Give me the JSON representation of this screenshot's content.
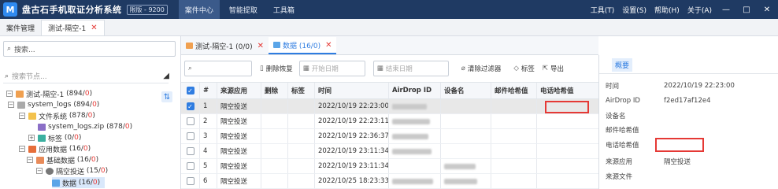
{
  "titlebar": {
    "logo": "M",
    "app_title": "盘古石手机取证分析系统",
    "edition": "限版 - 9200",
    "nav_tabs": [
      "案件中心",
      "智能提取",
      "工具箱"
    ],
    "menus": [
      "工具(T)",
      "设置(S)",
      "帮助(H)",
      "关于(A)"
    ],
    "win_buttons": [
      "—",
      "□",
      "✕"
    ]
  },
  "case_tabs": [
    {
      "label": "案件管理"
    },
    {
      "label": "测试-隔空-1",
      "close": "✕"
    }
  ],
  "left": {
    "search_placeholder": "搜索...",
    "filter_placeholder": "搜索节点...",
    "tree": [
      {
        "label": "测试-隔空-1",
        "count_a": "894",
        "count_b": "0"
      },
      {
        "label": "system_logs",
        "count_a": "894",
        "count_b": "0"
      },
      {
        "label": "文件系统",
        "count_a": "878",
        "count_b": "0"
      },
      {
        "label": "system_logs.zip",
        "count_a": "878",
        "count_b": "0"
      },
      {
        "label": "标签",
        "count_a": "0",
        "count_b": "0"
      },
      {
        "label": "应用数据",
        "count_a": "16",
        "count_b": "0"
      },
      {
        "label": "基础数据",
        "count_a": "16",
        "count_b": "0"
      },
      {
        "label": "隔空投送",
        "count_a": "15",
        "count_b": "0"
      },
      {
        "label": "数据",
        "count_a": "16",
        "count_b": "0"
      }
    ]
  },
  "middle": {
    "subtabs": [
      {
        "label": "测试-隔空-1 (0/0)",
        "close": "✕"
      },
      {
        "label": "数据 (16/0)",
        "close": "✕"
      }
    ],
    "toolbar": {
      "search_placeholder": "",
      "delete_restore": "删除恢复",
      "start_date": "开始日期",
      "end_date": "结束日期",
      "clear_filter": "清除过滤器",
      "tag": "标签",
      "export": "导出"
    },
    "columns": [
      "#",
      "来源应用",
      "删除",
      "标签",
      "时间",
      "AirDrop ID",
      "设备名",
      "邮件哈希值",
      "电话哈希值"
    ],
    "rows": [
      {
        "no": "1",
        "src": "隔空投送",
        "time": "2022/10/19 22:23:00",
        "checked": true
      },
      {
        "no": "2",
        "src": "隔空投送",
        "time": "2022/10/19 22:23:11",
        "checked": false
      },
      {
        "no": "3",
        "src": "隔空投送",
        "time": "2022/10/19 22:36:37",
        "checked": false
      },
      {
        "no": "4",
        "src": "隔空投送",
        "time": "2022/10/19 23:11:34",
        "checked": false
      },
      {
        "no": "5",
        "src": "隔空投送",
        "time": "2022/10/19 23:11:34",
        "checked": false
      },
      {
        "no": "6",
        "src": "隔空投送",
        "time": "2022/10/25 18:23:33",
        "checked": false
      }
    ]
  },
  "detail": {
    "tab": "概要",
    "fields": [
      {
        "key": "时间",
        "value": "2022/10/19 22:23:00"
      },
      {
        "key": "AirDrop ID",
        "value": "f2ed17af12e4"
      },
      {
        "key": "设备名",
        "value": ""
      },
      {
        "key": "邮件哈希值",
        "value": ""
      },
      {
        "key": "电话哈希值",
        "value": ""
      },
      {
        "key": "来源应用",
        "value": "隔空投送"
      },
      {
        "key": "来源文件",
        "value": ""
      }
    ]
  },
  "colors": {
    "titlebar": "#1f3a63",
    "accent": "#2f7de1",
    "highlight": "#e53935"
  }
}
